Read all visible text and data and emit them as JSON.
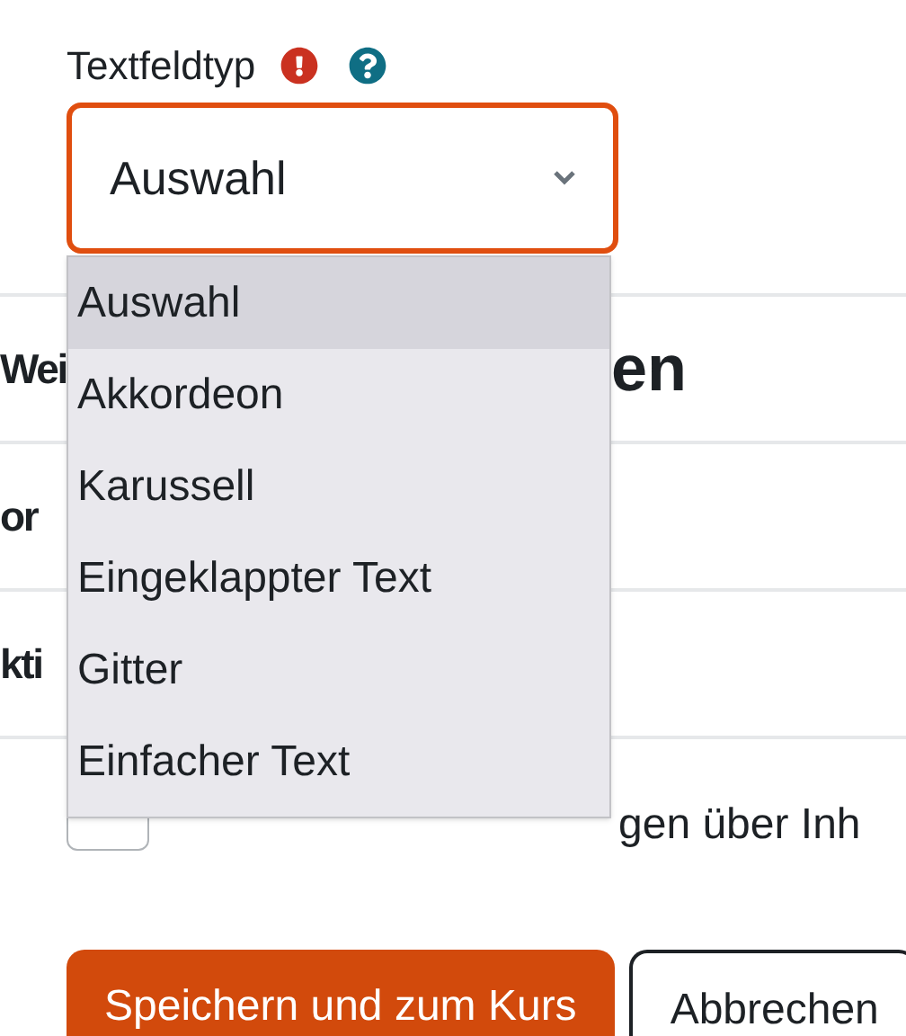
{
  "field": {
    "label": "Textfeldtyp",
    "required": true,
    "help": true,
    "value": "Auswahl",
    "focused": true
  },
  "dropdown": {
    "options": [
      {
        "label": "Auswahl",
        "selected": true
      },
      {
        "label": "Akkordeon",
        "selected": false
      },
      {
        "label": "Karussell",
        "selected": false
      },
      {
        "label": "Eingeklappter Text",
        "selected": false
      },
      {
        "label": "Gitter",
        "selected": false
      },
      {
        "label": "Einfacher Text",
        "selected": false
      }
    ]
  },
  "sections": [
    {
      "texts": [
        "Wei",
        "en"
      ]
    },
    {
      "texts": [
        "or"
      ]
    },
    {
      "texts": [
        "kti"
      ]
    }
  ],
  "checkbox": {
    "label": "gen über Inh",
    "checked": false
  },
  "buttons": [
    {
      "label": "Speichern und zum Kurs",
      "kind": "primary"
    },
    {
      "label": "Abbrechen",
      "kind": "secondary"
    }
  ]
}
